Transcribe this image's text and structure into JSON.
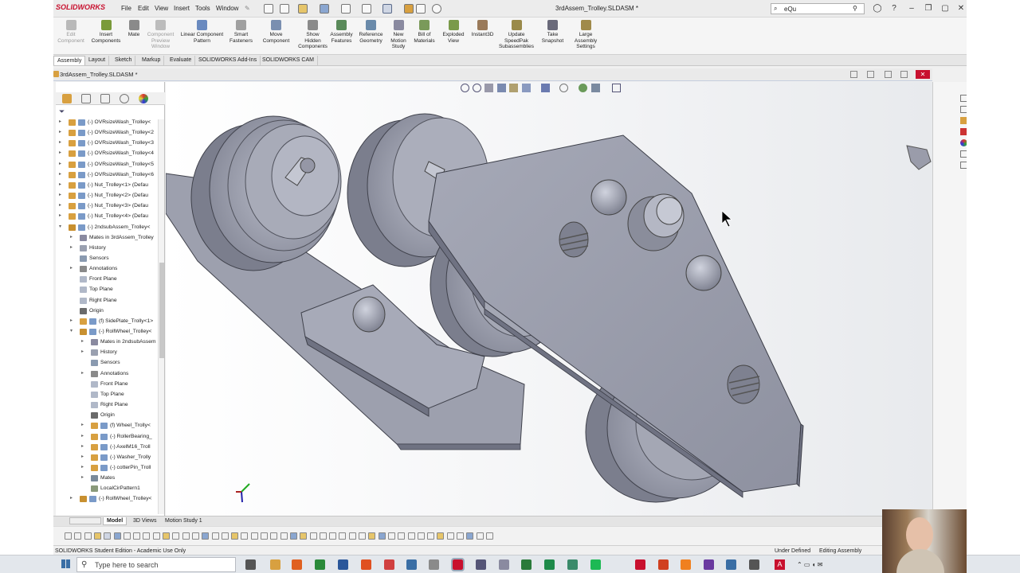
{
  "app": {
    "brand": "SOLIDWORKS",
    "title": "3rdAssem_Trolley.SLDASM *"
  },
  "menu": [
    "File",
    "Edit",
    "View",
    "Insert",
    "Tools",
    "Window"
  ],
  "search": {
    "value": "eQu"
  },
  "ribbon": [
    {
      "label": "Edit\nComponent",
      "disabled": true,
      "icon": "edit-component-icon",
      "color": "#b9b9b9"
    },
    {
      "label": "Insert\nComponents",
      "disabled": false,
      "icon": "insert-components-icon",
      "color": "#7a9a3a"
    },
    {
      "label": "Mate",
      "disabled": false,
      "icon": "mate-icon",
      "color": "#8a8a8a"
    },
    {
      "label": "Component\nPreview\nWindow",
      "disabled": true,
      "icon": "preview-window-icon",
      "color": "#bcbcbc"
    },
    {
      "label": "Linear Component\nPattern",
      "disabled": false,
      "icon": "linear-pattern-icon",
      "color": "#6a8abf"
    },
    {
      "label": "Smart\nFasteners",
      "disabled": false,
      "icon": "smart-fasteners-icon",
      "color": "#a0a0a0"
    },
    {
      "label": "Move\nComponent",
      "disabled": false,
      "icon": "move-component-icon",
      "color": "#7a8fb0"
    },
    {
      "label": "Show\nHidden\nComponents",
      "disabled": false,
      "icon": "show-hidden-icon",
      "color": "#8a8a8a"
    },
    {
      "label": "Assembly\nFeatures",
      "disabled": false,
      "icon": "assembly-features-icon",
      "color": "#5a8a5a"
    },
    {
      "label": "Reference\nGeometry",
      "disabled": false,
      "icon": "reference-geometry-icon",
      "color": "#6a8aaa"
    },
    {
      "label": "New\nMotion\nStudy",
      "disabled": false,
      "icon": "motion-study-icon",
      "color": "#8a8aa0"
    },
    {
      "label": "Bill of\nMaterials",
      "disabled": false,
      "icon": "bom-icon",
      "color": "#7a9a5a"
    },
    {
      "label": "Exploded\nView",
      "disabled": false,
      "icon": "exploded-view-icon",
      "color": "#7a9a4a"
    },
    {
      "label": "Instant3D",
      "disabled": false,
      "icon": "instant3d-icon",
      "color": "#9a7a5a"
    },
    {
      "label": "Update\nSpeedPak\nSubassemblies",
      "disabled": false,
      "icon": "speedpak-icon",
      "color": "#9a8a4a"
    },
    {
      "label": "Take\nSnapshot",
      "disabled": false,
      "icon": "snapshot-icon",
      "color": "#6a6a7a"
    },
    {
      "label": "Large\nAssembly\nSettings",
      "disabled": false,
      "icon": "large-assembly-icon",
      "color": "#a08a4a"
    }
  ],
  "command_tabs": [
    "Assembly",
    "Layout",
    "Sketch",
    "Markup",
    "Evaluate",
    "SOLIDWORKS Add-Ins",
    "SOLIDWORKS CAM"
  ],
  "active_command_tab": "Assembly",
  "document": {
    "name": "3rdAssem_Trolley.SLDASM *"
  },
  "tree": [
    {
      "text": "(-) OVRsizeWash_Trolley<",
      "indent": 0,
      "exp": "▸",
      "icon": "part-icon"
    },
    {
      "text": "(-) OVRsizeWash_Trolley<2",
      "indent": 0,
      "exp": "▸",
      "icon": "part-icon"
    },
    {
      "text": "(-) OVRsizeWash_Trolley<3",
      "indent": 0,
      "exp": "▸",
      "icon": "part-icon"
    },
    {
      "text": "(-) OVRsizeWash_Trolley<4",
      "indent": 0,
      "exp": "▸",
      "icon": "part-icon"
    },
    {
      "text": "(-) OVRsizeWash_Trolley<5",
      "indent": 0,
      "exp": "▸",
      "icon": "part-icon"
    },
    {
      "text": "(-) OVRsizeWash_Trolley<6",
      "indent": 0,
      "exp": "▸",
      "icon": "part-icon"
    },
    {
      "text": "(-) Nut_Trolley<1> (Defau",
      "indent": 0,
      "exp": "▸",
      "icon": "part-icon"
    },
    {
      "text": "(-) Nut_Trolley<2> (Defau",
      "indent": 0,
      "exp": "▸",
      "icon": "part-icon"
    },
    {
      "text": "(-) Nut_Trolley<3> (Defau",
      "indent": 0,
      "exp": "▸",
      "icon": "part-icon"
    },
    {
      "text": "(-) Nut_Trolley<4> (Defau",
      "indent": 0,
      "exp": "▸",
      "icon": "part-icon"
    },
    {
      "text": "(-) 2ndsubAssem_Trolley<",
      "indent": 0,
      "exp": "▾",
      "icon": "assembly-icon"
    },
    {
      "text": "Mates in 3rdAssem_Trolley",
      "indent": 1,
      "exp": "▸",
      "icon": "mates-folder-icon"
    },
    {
      "text": "History",
      "indent": 1,
      "exp": "▸",
      "icon": "history-icon"
    },
    {
      "text": "Sensors",
      "indent": 1,
      "exp": "",
      "icon": "sensors-icon"
    },
    {
      "text": "Annotations",
      "indent": 1,
      "exp": "▸",
      "icon": "annotations-icon"
    },
    {
      "text": "Front Plane",
      "indent": 1,
      "exp": "",
      "icon": "plane-icon"
    },
    {
      "text": "Top Plane",
      "indent": 1,
      "exp": "",
      "icon": "plane-icon"
    },
    {
      "text": "Right Plane",
      "indent": 1,
      "exp": "",
      "icon": "plane-icon"
    },
    {
      "text": "Origin",
      "indent": 1,
      "exp": "",
      "icon": "origin-icon"
    },
    {
      "text": "(f) SidePlate_Trolly<1>",
      "indent": 1,
      "exp": "▸",
      "icon": "part-icon"
    },
    {
      "text": "(-) RollWheel_Trolley<",
      "indent": 1,
      "exp": "▾",
      "icon": "assembly-icon"
    },
    {
      "text": "Mates in 2ndsubAssem",
      "indent": 2,
      "exp": "▸",
      "icon": "mates-folder-icon"
    },
    {
      "text": "History",
      "indent": 2,
      "exp": "▸",
      "icon": "history-icon"
    },
    {
      "text": "Sensors",
      "indent": 2,
      "exp": "",
      "icon": "sensors-icon"
    },
    {
      "text": "Annotations",
      "indent": 2,
      "exp": "▸",
      "icon": "annotations-icon"
    },
    {
      "text": "Front Plane",
      "indent": 2,
      "exp": "",
      "icon": "plane-icon"
    },
    {
      "text": "Top Plane",
      "indent": 2,
      "exp": "",
      "icon": "plane-icon"
    },
    {
      "text": "Right Plane",
      "indent": 2,
      "exp": "",
      "icon": "plane-icon"
    },
    {
      "text": "Origin",
      "indent": 2,
      "exp": "",
      "icon": "origin-icon"
    },
    {
      "text": "(f) Wheel_Trolly<",
      "indent": 2,
      "exp": "▸",
      "icon": "part-icon"
    },
    {
      "text": "(-) RollerBearing_",
      "indent": 2,
      "exp": "▸",
      "icon": "part-icon"
    },
    {
      "text": "(-) AxelM16_Troll",
      "indent": 2,
      "exp": "▸",
      "icon": "part-icon"
    },
    {
      "text": "(-) Washer_Trolly",
      "indent": 2,
      "exp": "▸",
      "icon": "part-icon"
    },
    {
      "text": "(-) cotterPin_Troll",
      "indent": 2,
      "exp": "▸",
      "icon": "part-icon"
    },
    {
      "text": "Mates",
      "indent": 2,
      "exp": "▸",
      "icon": "mates-icon"
    },
    {
      "text": "LocalCirPattern1",
      "indent": 2,
      "exp": "",
      "icon": "pattern-icon"
    },
    {
      "text": "(-) RollWheel_Trolley<",
      "indent": 1,
      "exp": "▸",
      "icon": "assembly-icon"
    }
  ],
  "bottom_tabs": [
    "Model",
    "3D Views",
    "Motion Study 1"
  ],
  "active_bottom_tab": "Model",
  "status": {
    "left": "SOLIDWORKS Student Edition - Academic Use Only",
    "under_defined": "Under Defined",
    "editing": "Editing Assembly"
  },
  "taskbar": {
    "search_placeholder": "Type here to search"
  },
  "colors": {
    "accent": "#c8102e",
    "part_fill": "#9ea1af",
    "part_dark": "#6f7282",
    "part_light": "#c0c3cf"
  }
}
